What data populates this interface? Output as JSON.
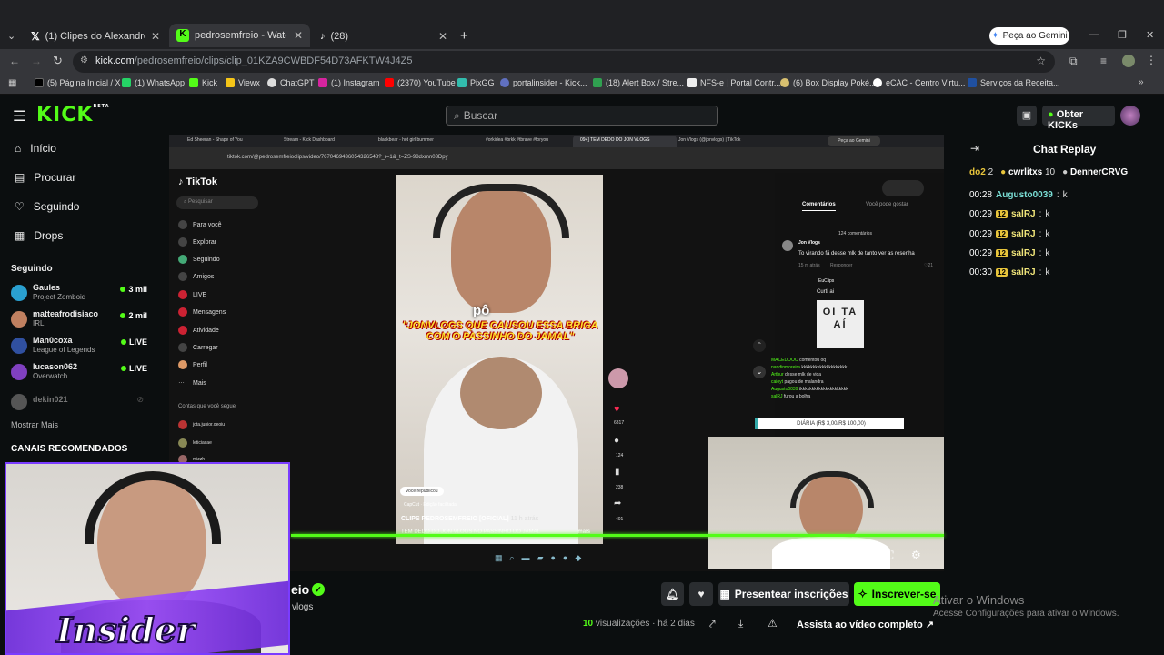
{
  "browser": {
    "tabs": [
      {
        "label": "(1) Clipes do Alexandre ʙʀ no X",
        "fav": "#000000"
      },
      {
        "label": "pedrosemfreio - Watch clip",
        "fav": "#53fc18"
      },
      {
        "label": "(28)",
        "fav": "#000000"
      }
    ],
    "gemini_button": "Peça ao Gemini",
    "url_host": "kick.com",
    "url_path": "/pedrosemfreio/clips/clip_01KZA9CWBDF54D73AFKTW4J4Z5",
    "bookmarks": [
      "(5) Página Inicial / X",
      "(1) WhatsApp",
      "Kick",
      "Viewx",
      "ChatGPT",
      "(1) Instagram",
      "(2370) YouTube",
      "PixGG",
      "portalinsider - Kick...",
      "(18) Alert Box / Stre...",
      "NFS-e | Portal Contr...",
      "(6) Box Display Poké...",
      "eCAC - Centro Virtu...",
      "Serviços da Receita..."
    ]
  },
  "kick": {
    "logo": "KICK",
    "logo_beta": "BETA",
    "search_placeholder": "Buscar",
    "get_kicks": "Obter KICKs",
    "nav": [
      "Início",
      "Procurar",
      "Seguindo",
      "Drops"
    ],
    "following_title": "Seguindo",
    "following": [
      {
        "name": "Gaules",
        "game": "Project Zomboid",
        "count": "3 mil",
        "color": "#2aa0d0"
      },
      {
        "name": "matteafrodisiaco",
        "game": "IRL",
        "count": "2 mil",
        "color": "#c08060"
      },
      {
        "name": "Man0coxa",
        "game": "League of Legends",
        "count": "LIVE",
        "color": "#3050a0"
      },
      {
        "name": "lucason062",
        "game": "Overwatch",
        "count": "LIVE",
        "color": "#8040c0"
      }
    ],
    "offline_user": "dekin021",
    "show_more": "Mostrar Mais",
    "recommended": "CANAIS RECOMENDADOS"
  },
  "tiktok_inner": {
    "tabs": [
      "Ed Sheeran - Shape of You",
      "Stream - Kick Dashboard",
      "blackbear - hot girl bummer",
      "#orkidea #brkk #tbrave #foryou",
      "09+] TEM DEDO DO JON VLOGS",
      "Jon Vlogs (@jonvlogs) | TikTok"
    ],
    "gemini": "Peça ao Gemini",
    "url": "tiktok.com/@pedrosemfreioclips/video/7670469436054326548?_r=1&_t=ZS-98dxmn03Dpy",
    "logo": "TikTok",
    "search": "Pesquisar",
    "menu": [
      "Para você",
      "Explorar",
      "Seguindo",
      "Amigos",
      "LIVE",
      "Mensagens",
      "Atividade",
      "Carregar",
      "Perfil",
      "Mais"
    ],
    "follows_title": "Contas que você segue",
    "follows": [
      "jota.junior.oeoiu",
      "leticiacae",
      "mizzh"
    ],
    "caption_top": "pô",
    "caption": "\"JONVLOGS QUE CAUSOU ESSA BRIGA COM O PASSINHO DO JAMAL\"",
    "repost": "Você republicou",
    "capcut": "CapCut · Edição facilitada",
    "author": "CLIPS PEDROSEMFREIO [OFICIAL]",
    "time": "11 h atrás",
    "desc": "TEM DEDO DO JON VLOGS NO PASSINHO DO JAMAL",
    "more": "mais",
    "likes": "6317",
    "comments": "124",
    "saves": "238",
    "shares": "401",
    "tab_comments": "Comentários",
    "tab_like": "Você pode gostar",
    "comment_count": "124 comentários",
    "c1_user": "Jon Vlogs",
    "c1_text": "To virando fã desse mlk de tanto ver as resenha",
    "c1_meta": "15 m atrás",
    "reply": "Responder",
    "c1_likes": "21",
    "c2_user": "EuClips",
    "c2_text": "Curti ai",
    "sticker": "OI TA AÍ",
    "overlay_lines": [
      "comentou oq",
      "kkkkkkkkkkkkkkkkkkkk",
      "desse mlk de vida",
      "pagou de malandra",
      "tkkkkkkkkkkkkkkkkkkkkk",
      "furou a bolha",
      "k"
    ],
    "overlay_users": [
      "MACEDOOO",
      "nandinmoreira",
      "Arthur",
      "caioyt",
      "Augusto0039",
      "salRJ"
    ],
    "diaria": "DIÁRIA (R$ 3,00/R$ 100,00)"
  },
  "streamer": {
    "overlay_logo": "Insider",
    "channel_name_partial": "eio",
    "subline": "vlogs"
  },
  "clip_actions": {
    "gift": "Presentear inscrições",
    "subscribe": "Inscrever-se",
    "views_num": "10",
    "views_label": "visualizações",
    "ago": "há 2 dias",
    "watch_full": "Assista ao vídeo completo"
  },
  "chat": {
    "title": "Chat Replay",
    "top_users": [
      {
        "name": "do2",
        "n": "2"
      },
      {
        "name": "cwrlitxs",
        "n": "10"
      },
      {
        "name": "DennerCRVG",
        "n": ""
      }
    ],
    "messages": [
      {
        "time": "00:28",
        "badge": "",
        "user": "Augusto0039",
        "text": "k"
      },
      {
        "time": "00:29",
        "badge": "12",
        "user": "salRJ",
        "text": "k"
      },
      {
        "time": "00:29",
        "badge": "12",
        "user": "salRJ",
        "text": "k"
      },
      {
        "time": "00:29",
        "badge": "12",
        "user": "salRJ",
        "text": "k"
      },
      {
        "time": "00:30",
        "badge": "12",
        "user": "salRJ",
        "text": "k"
      }
    ]
  },
  "windows": {
    "activate_title": "Ativar o Windows",
    "activate_sub": "Acesse Configurações para ativar o Windows."
  }
}
